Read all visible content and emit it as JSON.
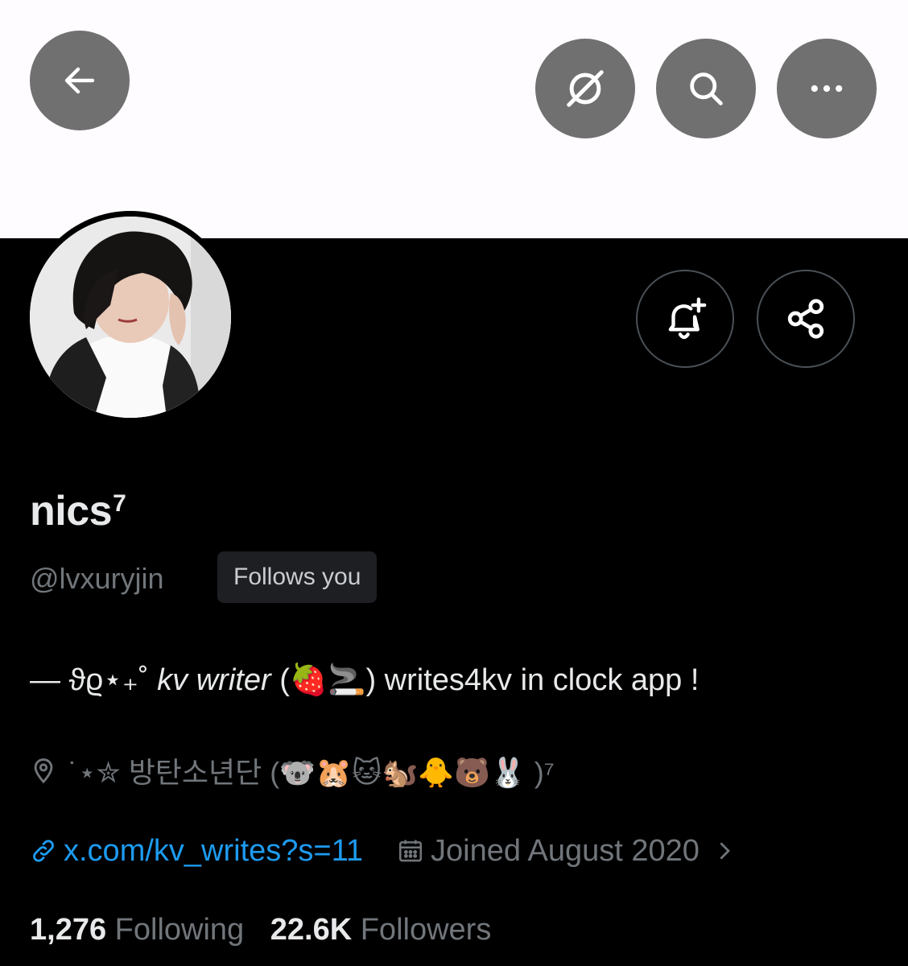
{
  "header": {
    "back_icon": "arrow-left-icon",
    "grok_icon": "grok-icon",
    "search_icon": "search-icon",
    "more_icon": "more-horizontal-icon"
  },
  "profile": {
    "display_name": "nics",
    "display_name_sup": "7",
    "handle": "@lvxuryjin",
    "follows_badge": "Follows you",
    "bio_prefix": "— ϑϱ⋆₊˚ ",
    "bio_italic": "kv writer",
    "bio_emoji": "(🍓🚬)",
    "bio_suffix": " writes4kv in clock app !",
    "location": "˙⋆✮ 방탄소년단 (🐨🐹🐱🐿️🐥🐻🐰 )⁷",
    "link": "x.com/kv_writes?s=11",
    "joined": "Joined August 2020",
    "following_count": "1,276",
    "following_label": "Following",
    "followers_count": "22.6K",
    "followers_label": "Followers"
  },
  "actions": {
    "notify_icon": "bell-plus-icon",
    "share_icon": "share-icon"
  },
  "colors": {
    "accent": "#1d9bf0",
    "muted": "#71767b",
    "text": "#e7e9ea",
    "header_button": "#707070"
  }
}
